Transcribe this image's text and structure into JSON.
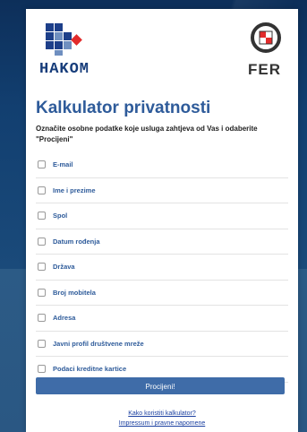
{
  "logos": {
    "left_name": "HAKOM",
    "right_name": "FER"
  },
  "header": {
    "title": "Kalkulator privatnosti",
    "instructions": "Označite osobne podatke koje usluga zahtjeva od Vas i odaberite \"Procijeni\""
  },
  "options": [
    {
      "label": "E-mail",
      "checked": false
    },
    {
      "label": "Ime i prezime",
      "checked": false
    },
    {
      "label": "Spol",
      "checked": false
    },
    {
      "label": "Datum rođenja",
      "checked": false
    },
    {
      "label": "Država",
      "checked": false
    },
    {
      "label": "Broj mobitela",
      "checked": false
    },
    {
      "label": "Adresa",
      "checked": false
    },
    {
      "label": "Javni profil društvene mreže",
      "checked": false
    },
    {
      "label": "Podaci kreditne kartice",
      "checked": false
    }
  ],
  "actions": {
    "submit_label": "Procijeni!"
  },
  "footer": {
    "help_link": "Kako koristiti kalkulator?",
    "legal_link": "Impressum i pravne napomene"
  },
  "colors": {
    "accent": "#2e5b9a",
    "button": "#3f6ca8",
    "background_dark": "#0d2f5a",
    "background_light": "#2c5b86"
  }
}
